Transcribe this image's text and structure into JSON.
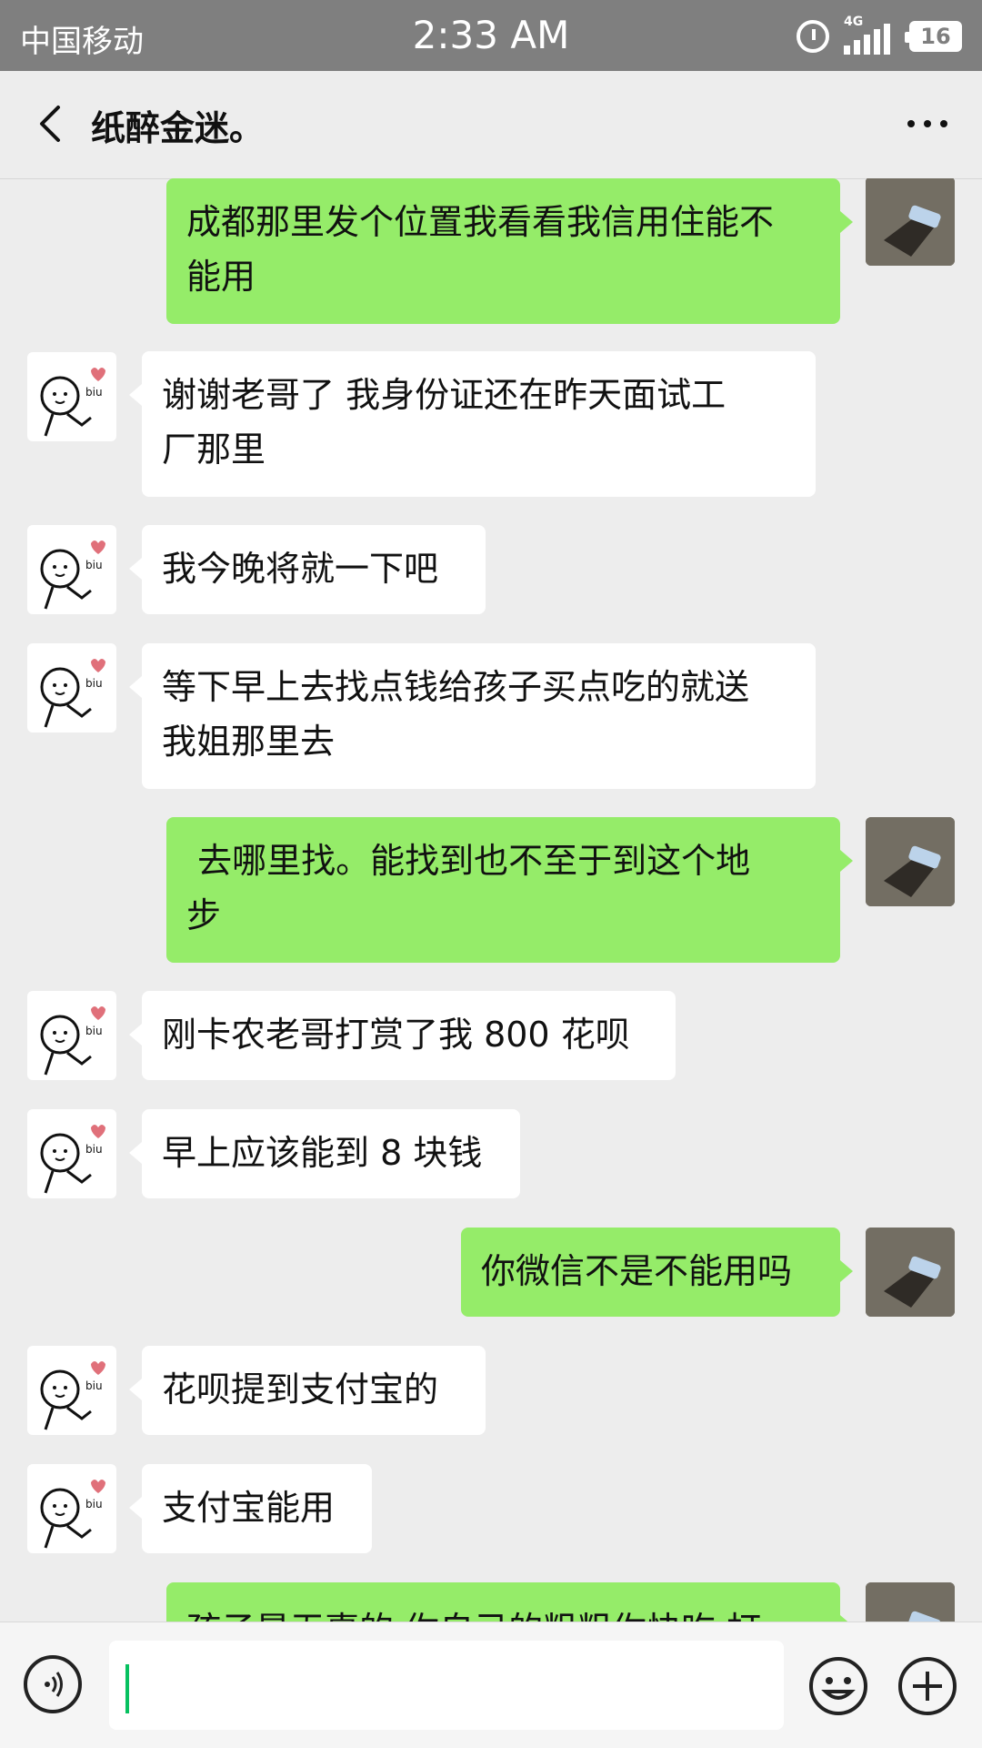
{
  "status_bar": {
    "carrier": "中国移动",
    "time": "2:33 AM",
    "network": "4G",
    "battery": "16"
  },
  "header": {
    "title": "纸醉金迷。"
  },
  "messages": [
    {
      "side": "out",
      "text_lines": [
        "成都那里发个位置我看看我信用住能不",
        "能用"
      ]
    },
    {
      "side": "in",
      "text_lines": [
        "谢谢老哥了  我身份证还在昨天面试工",
        "厂那里"
      ]
    },
    {
      "side": "in",
      "text_lines": [
        "我今晚将就一下吧"
      ]
    },
    {
      "side": "in",
      "text_lines": [
        "等下早上去找点钱给孩子买点吃的就送",
        "我姐那里去"
      ]
    },
    {
      "side": "out",
      "text_lines": [
        " 去哪里找。能找到也不至于到这个地",
        "步"
      ]
    },
    {
      "side": "in",
      "text_lines": [
        "刚卡农老哥打赏了我 800 花呗"
      ]
    },
    {
      "side": "in",
      "text_lines": [
        "早上应该能到 8 块钱"
      ]
    },
    {
      "side": "out",
      "text_lines": [
        "你微信不是不能用吗"
      ]
    },
    {
      "side": "in",
      "text_lines": [
        "花呗提到支付宝的"
      ]
    },
    {
      "side": "in",
      "text_lines": [
        "支付宝能用"
      ]
    },
    {
      "side": "out",
      "text_lines": [
        "孩子是无辜的 你自己的粗粗你快吃 打"
      ]
    }
  ],
  "avatar_in": {
    "badge_text": "biu"
  },
  "input": {
    "value": ""
  },
  "colors": {
    "sent_bubble": "#95ec69",
    "received_bubble": "#ffffff",
    "background": "#ededed"
  }
}
